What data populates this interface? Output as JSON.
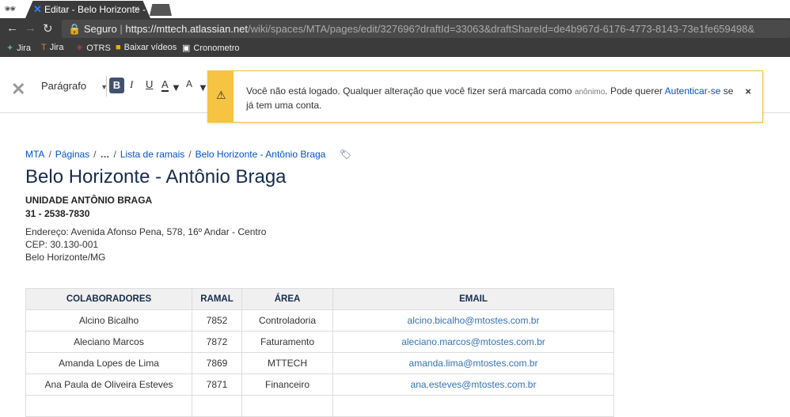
{
  "browser": {
    "tab_title": "Editar - Belo Horizonte -",
    "secure_label": "Seguro",
    "url_host": "https://mttech.atlassian.net",
    "url_path": "/wiki/spaces/MTA/pages/edit/327696?draftId=33063&draftShareId=de4b967d-6176-4773-8143-73e1fe659498&",
    "bookmarks": [
      "Jira",
      "Jira",
      "OTRS",
      "Baixar vídeos",
      "Cronometro"
    ]
  },
  "toolbar": {
    "paragraph": "Parágrafo",
    "bold": "B",
    "italic": "I",
    "underline": "U",
    "color": "A",
    "format": "A"
  },
  "notice": {
    "text1": "Você não está logado. Qualquer alteração que você fizer será marcada como ",
    "anon": "anônimo",
    "text2": ". Pode querer ",
    "link": "Autenticar-se",
    "text3": " se já tem uma conta.",
    "close": "×"
  },
  "breadcrumb": [
    "MTA",
    "Páginas",
    "…",
    "Lista de ramais",
    "Belo Horizonte - Antônio Braga"
  ],
  "page": {
    "title": "Belo Horizonte - Antônio Braga",
    "unit": "UNIDADE ANTÔNIO BRAGA",
    "phone": "31 - 2538-7830",
    "address": "Endereço: Avenida Afonso Pena, 578, 16º Andar - Centro",
    "cep": "CEP: 30.130-001",
    "city": "Belo Horizonte/MG"
  },
  "table": {
    "headers": [
      "COLABORADORES",
      "RAMAL",
      "ÁREA",
      "EMAIL"
    ],
    "rows": [
      [
        "Alcino Bicalho",
        "7852",
        "Controladoria",
        "alcino.bicalho@mtostes.com.br"
      ],
      [
        "Aleciano Marcos",
        "7872",
        "Faturamento",
        "aleciano.marcos@mtostes.com.br"
      ],
      [
        "Amanda Lopes de Lima",
        "7869",
        "MTTECH",
        "amanda.lima@mtostes.com.br"
      ],
      [
        "Ana Paula de Oliveira Esteves",
        "7871",
        "Financeiro",
        "ana.esteves@mtostes.com.br"
      ],
      [
        "",
        "",
        "",
        ""
      ]
    ]
  }
}
